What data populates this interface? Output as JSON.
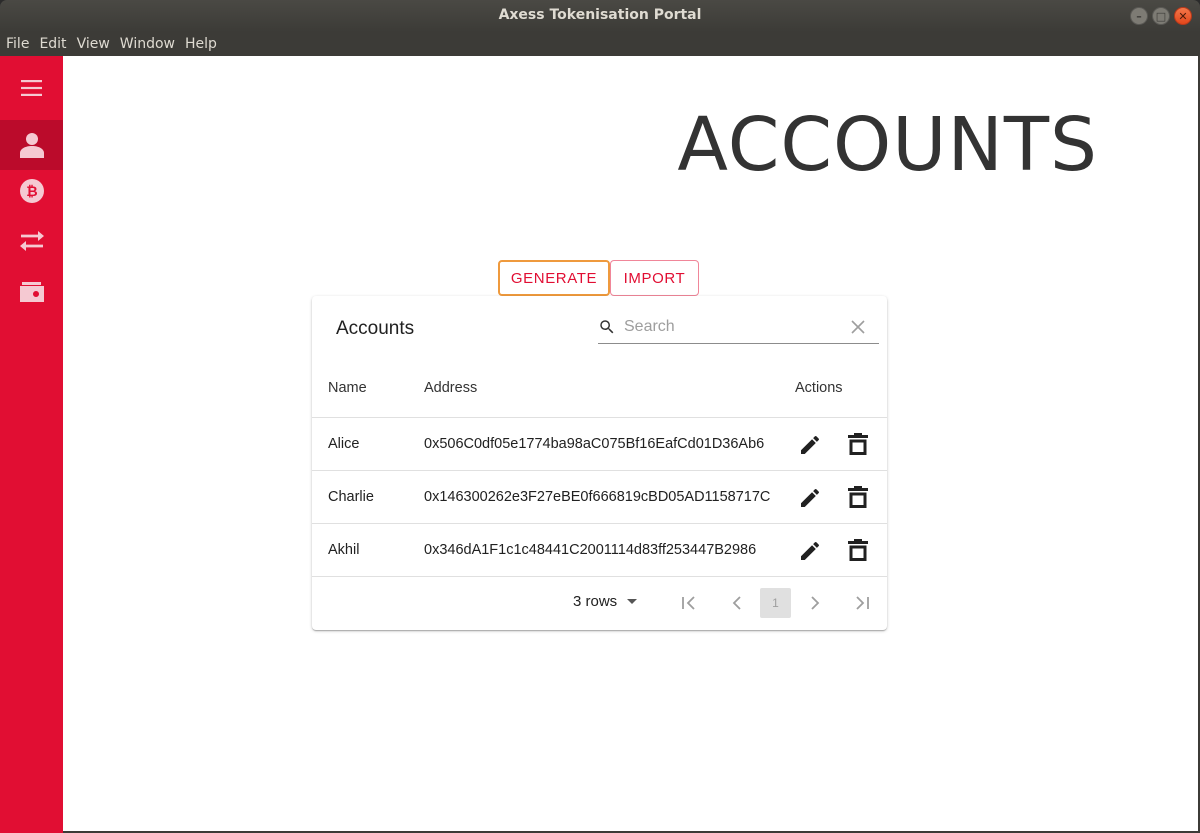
{
  "window": {
    "title": "Axess Tokenisation Portal"
  },
  "menu": [
    "File",
    "Edit",
    "View",
    "Window",
    "Help"
  ],
  "sidebar": {
    "items": [
      {
        "icon": "menu-icon"
      },
      {
        "icon": "person-icon",
        "active": true
      },
      {
        "icon": "bitcoin-icon"
      },
      {
        "icon": "swap-icon"
      },
      {
        "icon": "wallet-icon"
      }
    ]
  },
  "page": {
    "title": "ACCOUNTS"
  },
  "actions": {
    "generate": "GENERATE",
    "import": "IMPORT"
  },
  "table": {
    "title": "Accounts",
    "search_placeholder": "Search",
    "columns": [
      "Name",
      "Address",
      "Actions"
    ],
    "rows": [
      {
        "name": "Alice",
        "address": "0x506C0df05e1774ba98aC075Bf16EafCd01D36Ab6"
      },
      {
        "name": "Charlie",
        "address": "0x146300262e3F27eBE0f666819cBD05AD1158717C"
      },
      {
        "name": "Akhil",
        "address": "0x346dA1F1c1c48441C2001114d83ff253447B2986"
      }
    ],
    "rows_per_page": "3 rows",
    "current_page": "1"
  },
  "colors": {
    "brand": "#e10e33",
    "brand_dark": "#bb0b2b",
    "focus": "#ef9a3d"
  }
}
